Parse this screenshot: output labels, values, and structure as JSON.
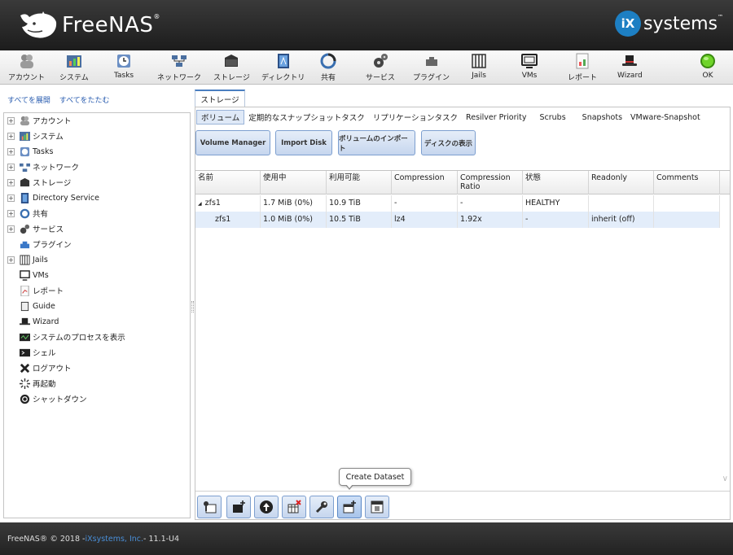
{
  "brand": {
    "name": "FreeNAS",
    "tm": "®",
    "vendor_badge": "iX",
    "vendor_text": "systems",
    "vendor_tm": "™"
  },
  "toolbar": [
    {
      "label": "アカウント",
      "icon": "users-icon"
    },
    {
      "label": "システム",
      "icon": "system-icon"
    },
    {
      "label": "Tasks",
      "icon": "tasks-icon"
    },
    {
      "label": "ネットワーク",
      "icon": "network-icon"
    },
    {
      "label": "ストレージ",
      "icon": "storage-icon"
    },
    {
      "label": "ディレクトリ",
      "icon": "directory-icon"
    },
    {
      "label": "共有",
      "icon": "sharing-icon"
    },
    {
      "label": "サービス",
      "icon": "services-icon"
    },
    {
      "label": "プラグイン",
      "icon": "plugins-icon"
    },
    {
      "label": "Jails",
      "icon": "jails-icon"
    },
    {
      "label": "VMs",
      "icon": "vms-icon"
    },
    {
      "label": "レポート",
      "icon": "reporting-icon"
    },
    {
      "label": "Wizard",
      "icon": "wizard-icon"
    },
    {
      "label": "OK",
      "icon": "status-ok-icon"
    }
  ],
  "left": {
    "expand_all": "すべてを展開",
    "collapse_all": "すべてをたたむ",
    "tree": [
      {
        "label": "アカウント",
        "expandable": true
      },
      {
        "label": "システム",
        "expandable": true
      },
      {
        "label": "Tasks",
        "expandable": true
      },
      {
        "label": "ネットワーク",
        "expandable": true
      },
      {
        "label": "ストレージ",
        "expandable": true
      },
      {
        "label": "Directory Service",
        "expandable": true
      },
      {
        "label": "共有",
        "expandable": true
      },
      {
        "label": "サービス",
        "expandable": true
      },
      {
        "label": "プラグイン",
        "expandable": false
      },
      {
        "label": "Jails",
        "expandable": true
      },
      {
        "label": "VMs",
        "expandable": false
      },
      {
        "label": "レポート",
        "expandable": false
      },
      {
        "label": "Guide",
        "expandable": false
      },
      {
        "label": "Wizard",
        "expandable": false
      },
      {
        "label": "システムのプロセスを表示",
        "expandable": false
      },
      {
        "label": "シェル",
        "expandable": false
      },
      {
        "label": "ログアウト",
        "expandable": false
      },
      {
        "label": "再起動",
        "expandable": false
      },
      {
        "label": "シャットダウン",
        "expandable": false
      }
    ]
  },
  "main": {
    "tab": "ストレージ",
    "subtabs": [
      "ボリューム",
      "定期的なスナップショットタスク",
      "リプリケーションタスク",
      "Resilver Priority",
      "Scrubs",
      "Snapshots",
      "VMware-Snapshot"
    ],
    "actions": [
      "Volume Manager",
      "Import Disk",
      "ボリュームのインポート",
      "ディスクの表示"
    ],
    "columns": [
      "名前",
      "使用中",
      "利用可能",
      "Compression",
      "Compression Ratio",
      "状態",
      "Readonly",
      "Comments"
    ],
    "rows": [
      {
        "name": "zfs1",
        "used": "1.7 MiB (0%)",
        "avail": "10.9 TiB",
        "compression": "-",
        "ratio": "-",
        "status": "HEALTHY",
        "readonly": "",
        "comments": "",
        "expander": "◢"
      },
      {
        "name": "zfs1",
        "used": "1.0 MiB (0%)",
        "avail": "10.5 TiB",
        "compression": "lz4",
        "ratio": "1.92x",
        "status": "-",
        "readonly": "inherit (off)",
        "comments": ""
      }
    ],
    "tooltip": "Create Dataset"
  },
  "footer": {
    "prefix": "FreeNAS® © 2018 - ",
    "company": "iXsystems, Inc.",
    "suffix": " - 11.1-U4"
  },
  "colors": {
    "accent": "#1d7fc3",
    "header_bg": "#2b2b2b",
    "ok_green": "#5fc21e"
  }
}
